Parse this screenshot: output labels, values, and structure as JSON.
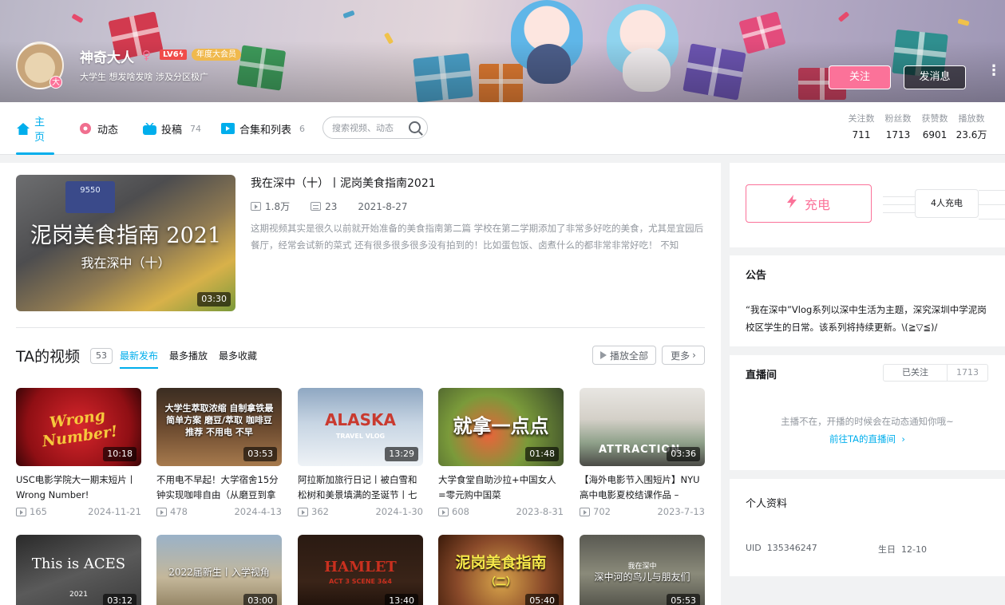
{
  "header": {
    "username": "神奇大人",
    "gender_symbol": "♀",
    "level": "LV6",
    "level_badge": "ϟ",
    "medal": "年度大会员",
    "avatar_badge": "大",
    "signature": "大学生 想发啥发啥 涉及分区极广",
    "follow_label": "关注",
    "message_label": "发消息",
    "more_glyph": "⋮"
  },
  "nav": {
    "tabs": [
      {
        "label": "主页",
        "count": ""
      },
      {
        "label": "动态",
        "count": ""
      },
      {
        "label": "投稿",
        "count": "74"
      },
      {
        "label": "合集和列表",
        "count": "6"
      }
    ],
    "search_placeholder": "搜索视频、动态",
    "stats": [
      {
        "label": "关注数",
        "value": "711"
      },
      {
        "label": "粉丝数",
        "value": "1713"
      },
      {
        "label": "获赞数",
        "value": "6901"
      },
      {
        "label": "播放数",
        "value": "23.6万"
      }
    ]
  },
  "featured": {
    "thumb_big_text": "泥岗美食指南 2021",
    "thumb_sub_text": "我在深中（十）",
    "screen_text": "9550",
    "duration": "03:30",
    "title": "我在深中（十）丨泥岗美食指南2021",
    "views": "1.8万",
    "danmaku": "23",
    "date": "2021-8-27",
    "description": "这期视频其实是很久以前就开始准备的美食指南第二篇 学校在第二学期添加了非常多好吃的美食，尤其是宜园后餐厅，经常会试新的菜式 还有很多很多很多没有拍到的！比如蛋包饭、卤煮什么的都非常非常好吃！ 不知"
  },
  "videos_section": {
    "title": "TA的视频",
    "count": "53",
    "tabs": [
      "最新发布",
      "最多播放",
      "最多收藏"
    ],
    "play_all_label": "播放全部",
    "more_label": "更多",
    "more_glyph": "›"
  },
  "videos": [
    {
      "thumb_text": "Wrong Number!",
      "duration": "10:18",
      "title": "USC电影学院大一期末短片丨Wrong Number!",
      "views": "165",
      "date": "2024-11-21"
    },
    {
      "thumb_text": "大学生萃取浓缩 自制拿铁最简单方案 磨豆/萃取 咖啡豆推荐 不用电 不早",
      "duration": "03:53",
      "title": "不用电不早起！大学宿舍15分钟实现咖啡自由（从磨豆到拿",
      "views": "478",
      "date": "2024-4-13"
    },
    {
      "thumb_text": "ALASKA",
      "thumb_sub": "TRAVEL VLOG",
      "duration": "13:29",
      "title": "阿拉斯加旅行日记丨被白雪和松树和美景填满的圣诞节丨七",
      "views": "362",
      "date": "2024-1-30"
    },
    {
      "thumb_text": "就拿一点点",
      "duration": "01:48",
      "title": "大学食堂自助沙拉+中国女人=零元购中国菜",
      "views": "608",
      "date": "2023-8-31"
    },
    {
      "thumb_text": "ATTRACTION",
      "duration": "03:36",
      "title": "【海外电影节入围短片】NYU高中电影夏校结课作品 –",
      "views": "702",
      "date": "2023-7-13"
    }
  ],
  "videos_row2": [
    {
      "thumb_text": "This is ACES",
      "thumb_sub": "2021",
      "duration": "03:12"
    },
    {
      "thumb_text": "2022届新生丨入学视角",
      "duration": "03:00"
    },
    {
      "thumb_text": "HAMLET",
      "thumb_sub": "ACT 3 SCENE 3&4",
      "duration": "13:40"
    },
    {
      "thumb_text": "泥岗美食指南",
      "thumb_sub": "（二）",
      "duration": "05:40"
    },
    {
      "thumb_text": "我在深中",
      "thumb_sub": "深中河的鸟儿与朋友们",
      "duration": "05:53"
    }
  ],
  "charge": {
    "button_label": "充电",
    "count_label": "4人充电"
  },
  "notice": {
    "title": "公告",
    "text": "“我在深中”Vlog系列以深中生活为主题，深究深圳中学泥岗校区学生的日常。该系列将持续更新。\\(≧▽≦)/"
  },
  "live": {
    "title": "直播间",
    "followed_label": "已关注",
    "followed_count": "1713",
    "message": "主播不在，开播的时候会在动态通知你哦~",
    "link_label": "前往TA的直播间",
    "link_glyph": "›"
  },
  "profile": {
    "title": "个人资料",
    "uid_label": "UID",
    "uid": "135346247",
    "birthday_label": "生日",
    "birthday": "12-10"
  }
}
